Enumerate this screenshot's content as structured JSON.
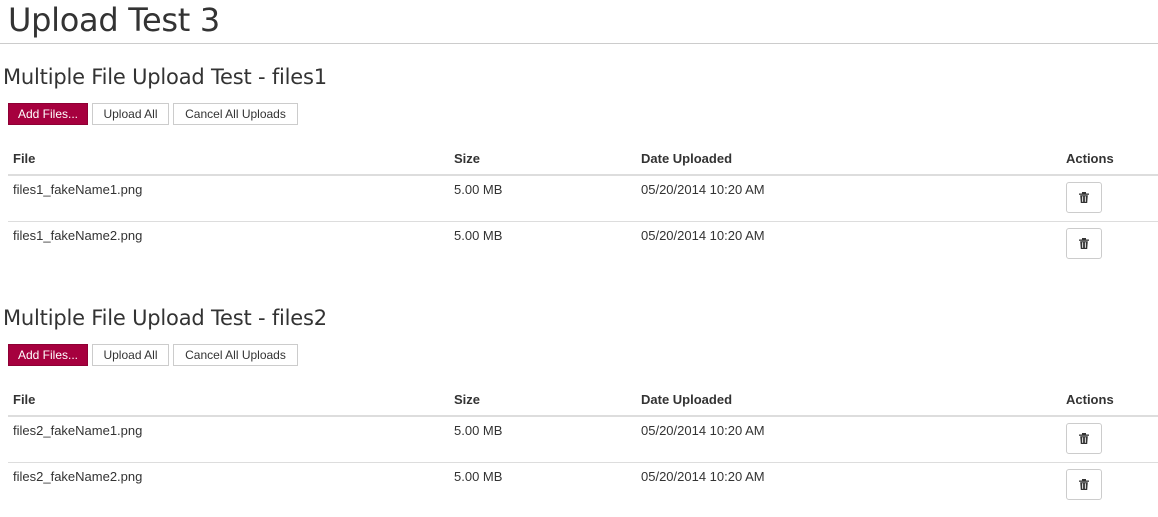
{
  "page": {
    "title": "Upload Test 3"
  },
  "colors": {
    "primary_button": "#a6003e",
    "rule": "#dddddd",
    "text": "#333333"
  },
  "columns": {
    "file": "File",
    "size": "Size",
    "date": "Date Uploaded",
    "actions": "Actions"
  },
  "sections": [
    {
      "title": "Multiple File Upload Test - files1",
      "buttons": {
        "add": "Add Files...",
        "upload": "Upload All",
        "cancel": "Cancel All Uploads"
      },
      "rows": [
        {
          "file": "files1_fakeName1.png",
          "size": "5.00 MB",
          "date": "05/20/2014 10:20 AM",
          "action_icon": "trash-icon"
        },
        {
          "file": "files1_fakeName2.png",
          "size": "5.00 MB",
          "date": "05/20/2014 10:20 AM",
          "action_icon": "trash-icon"
        }
      ]
    },
    {
      "title": "Multiple File Upload Test - files2",
      "buttons": {
        "add": "Add Files...",
        "upload": "Upload All",
        "cancel": "Cancel All Uploads"
      },
      "rows": [
        {
          "file": "files2_fakeName1.png",
          "size": "5.00 MB",
          "date": "05/20/2014 10:20 AM",
          "action_icon": "trash-icon"
        },
        {
          "file": "files2_fakeName2.png",
          "size": "5.00 MB",
          "date": "05/20/2014 10:20 AM",
          "action_icon": "trash-icon"
        }
      ]
    }
  ]
}
